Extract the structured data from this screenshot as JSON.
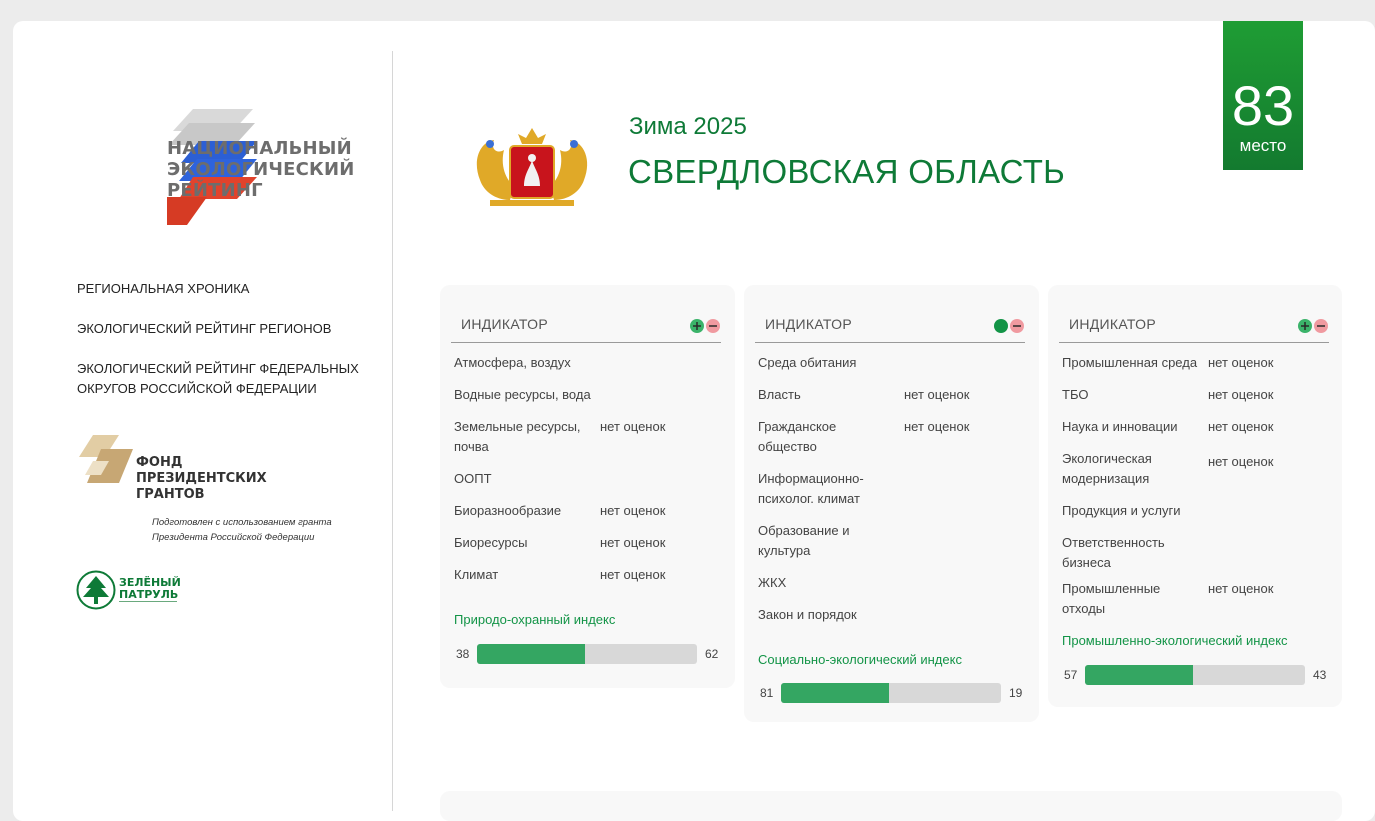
{
  "logo": {
    "lines": [
      "НАЦИОНАЛЬНЫЙ",
      "ЭКОЛОГИЧЕСКИЙ",
      "РЕЙТИНГ"
    ]
  },
  "nav": [
    {
      "lines": [
        "РЕГИОНАЛЬНАЯ ХРОНИКА"
      ]
    },
    {
      "lines": [
        "ЭКОЛОГИЧЕСКИЙ РЕЙТИНГ РЕГИОНОВ"
      ]
    },
    {
      "lines": [
        "ЭКОЛОГИЧЕСКИЙ РЕЙТИНГ ФЕДЕРАЛЬНЫХ",
        "ОКРУГОВ РОССИЙСКОЙ ФЕДЕРАЦИИ"
      ]
    }
  ],
  "fund": {
    "lines": [
      "ФОНД",
      "ПРЕЗИДЕНТСКИХ",
      "ГРАНТОВ"
    ],
    "note": [
      "Подготовлен с использованием гранта",
      "Президента Российской Федерации"
    ]
  },
  "patrol": {
    "lines": [
      "ЗЕЛЁНЫЙ",
      "ПАТРУЛЬ"
    ]
  },
  "header": {
    "season": "Зима 2025",
    "region": "СВЕРДЛОВСКАЯ ОБЛАСТЬ",
    "rank": "83",
    "rank_label": "место"
  },
  "colors": {
    "brand_green": "#139447",
    "bar_fill": "#34a662",
    "bar_track": "#d8d8d8"
  },
  "panels": [
    {
      "header": "ИНДИКАТОР",
      "toggle_state": "plus-minus",
      "rows": [
        {
          "name": "Атмосфера, воздух",
          "value": ""
        },
        {
          "name": "Водные ресурсы, вода",
          "value": ""
        },
        {
          "name": "Земельные ресурсы, почва",
          "value": "нет оценок"
        },
        {
          "name": "ООПТ",
          "value": ""
        },
        {
          "name": "Биоразнообразие",
          "value": "нет оценок"
        },
        {
          "name": "Биоресурсы",
          "value": "нет оценок"
        },
        {
          "name": "Климат",
          "value": "нет оценок"
        }
      ],
      "index": {
        "label": "Природо-охранный индекс",
        "left": "38",
        "right": "62",
        "fill_percent": 49
      }
    },
    {
      "header": "ИНДИКАТОР",
      "toggle_state": "solid-minus",
      "rows": [
        {
          "name": "Среда обитания",
          "value": ""
        },
        {
          "name": "Власть",
          "value": "нет оценок"
        },
        {
          "name": "Гражданское общество",
          "value": "нет оценок"
        },
        {
          "name": "Информационно-психолог. климат",
          "value": ""
        },
        {
          "name": "Образование и культура",
          "value": ""
        },
        {
          "name": "ЖКХ",
          "value": ""
        },
        {
          "name": "Закон и порядок",
          "value": ""
        }
      ],
      "index": {
        "label": "Социально-экологический индекс",
        "left": "81",
        "right": "19",
        "fill_percent": 49
      }
    },
    {
      "header": "ИНДИКАТОР",
      "toggle_state": "plus-minus",
      "rows": [
        {
          "name": "Промышленная среда",
          "value": "нет оценок"
        },
        {
          "name": "ТБО",
          "value": "нет оценок"
        },
        {
          "name": "Наука и инновации",
          "value": "нет оценок"
        },
        {
          "name": "Экологическая модернизация",
          "value": "нет оценок"
        },
        {
          "name": "Продукция и услуги",
          "value": ""
        },
        {
          "name": "Ответственность бизнеса",
          "value": ""
        },
        {
          "name": "Промышленные отходы",
          "value": "нет оценок"
        }
      ],
      "index": {
        "label": "Промышленно-экологический индекс",
        "left": "57",
        "right": "43",
        "fill_percent": 49
      }
    }
  ]
}
